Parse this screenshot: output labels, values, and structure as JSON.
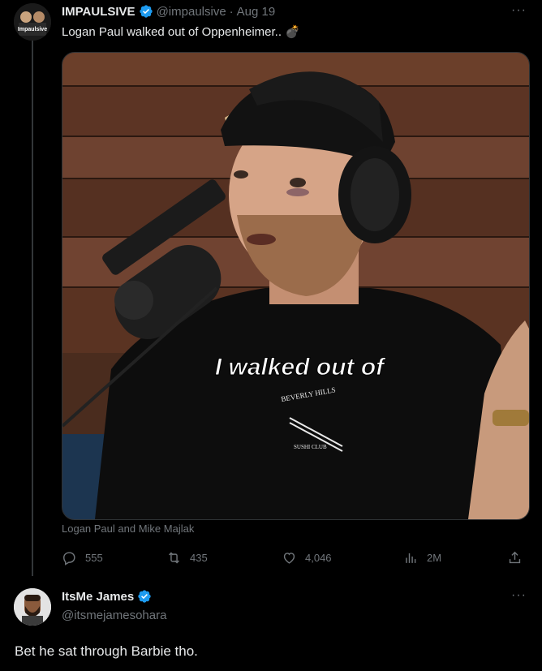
{
  "tweet": {
    "author_name": "IMPAULSIVE",
    "handle": "@impaulsive",
    "separator": "·",
    "date": "Aug 19",
    "text": "Logan Paul walked out of Oppenheimer..",
    "emoji": "💣",
    "media_caption_overlay": "I walked out of",
    "shirt_text_top": "BEVERLY HILLS",
    "shirt_text_bottom": "SUSHI CLUB",
    "media_credit": "Logan Paul and Mike Majlak",
    "avatar_text": "Impaulsive",
    "actions": {
      "replies": "555",
      "retweets": "435",
      "likes": "4,046",
      "views": "2M"
    }
  },
  "reply": {
    "author_name": "ItsMe James",
    "handle": "@itsmejamesohara",
    "text": "Bet he sat through Barbie tho."
  },
  "colors": {
    "background": "#000000",
    "text": "#e7e9ea",
    "muted": "#71767b",
    "verified": "#1d9bf0"
  }
}
